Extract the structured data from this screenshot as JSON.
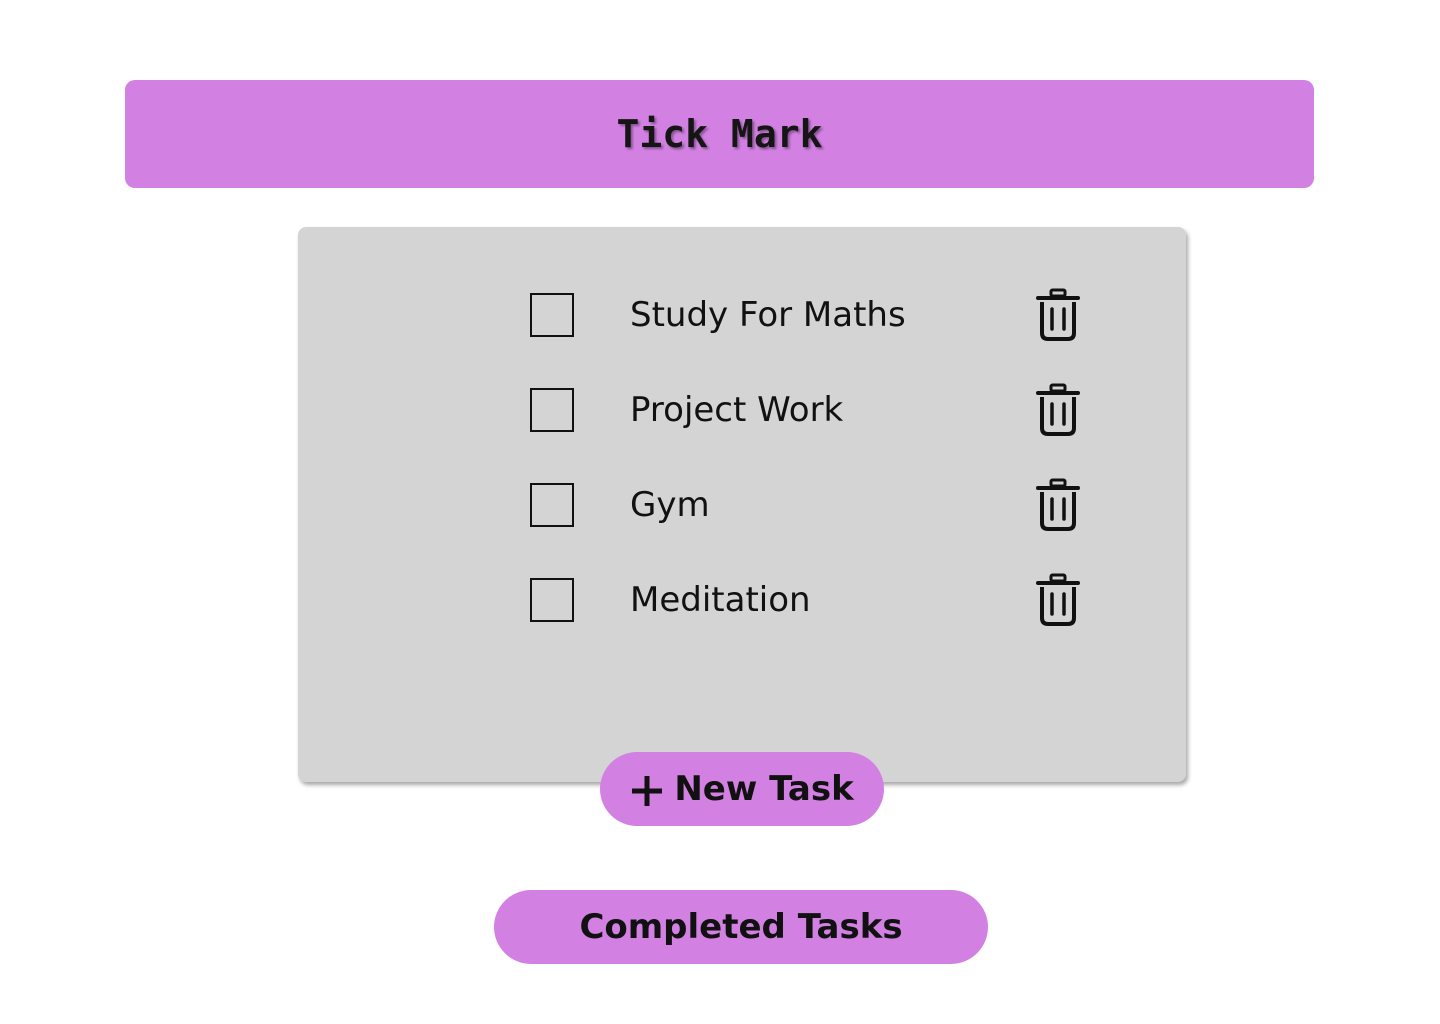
{
  "colors": {
    "accent": "#d280e2",
    "panel": "#d4d4d4",
    "text": "#111111",
    "background": "#ffffff"
  },
  "header": {
    "title": "Tick Mark"
  },
  "tasks": [
    {
      "label": "Study For Maths",
      "checked": false,
      "delete_icon": "trash-icon"
    },
    {
      "label": "Project Work",
      "checked": false,
      "delete_icon": "trash-icon"
    },
    {
      "label": "Gym",
      "checked": false,
      "delete_icon": "trash-icon"
    },
    {
      "label": "Meditation",
      "checked": false,
      "delete_icon": "trash-icon"
    }
  ],
  "actions": {
    "new_task_label": "New Task",
    "new_task_icon": "plus-icon",
    "completed_label": "Completed Tasks"
  }
}
